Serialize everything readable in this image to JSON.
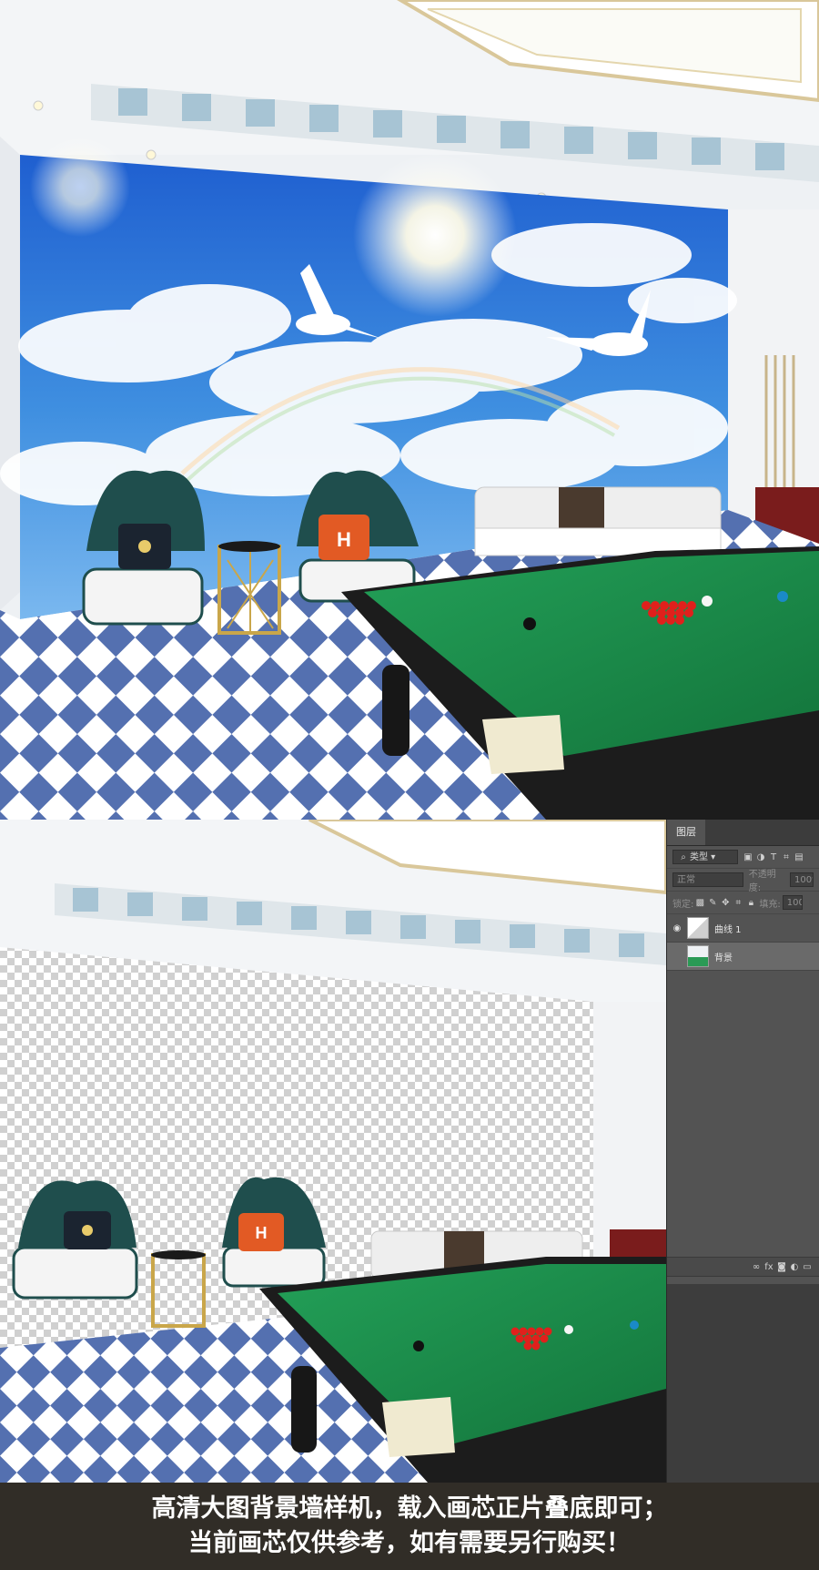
{
  "photoshop": {
    "panel_title": "图层",
    "filter_kind": "类型",
    "blend_mode": "正常",
    "opacity_label": "不透明度:",
    "opacity_value": "100%",
    "lock_label": "锁定:",
    "fill_label": "填充:",
    "fill_value": "100%",
    "footer_icons": [
      "link-icon",
      "fx-icon",
      "mask-icon",
      "adjustment-icon",
      "folder-icon"
    ],
    "layers": [
      {
        "name": "曲线 1",
        "visible": true,
        "selected": false,
        "icon": "curves-adjustment-icon"
      },
      {
        "name": "背景",
        "visible": false,
        "selected": true,
        "icon": "image-thumbnail-icon"
      }
    ]
  },
  "caption": {
    "line1": "高清大图背景墙样机，载入画芯正片叠底即可；",
    "line2": "当前画芯仅供参考，如有需要另行购买！"
  },
  "pillow_letter": "H",
  "colors": {
    "sky_top": "#1f5fd0",
    "sky_light": "#5aa8ec",
    "felt_green": "#1a8a4a",
    "tile_blue": "#5470b0",
    "chair_teal": "#1f4e4d",
    "pillow_orange": "#e25a24",
    "caption_bg": "#312d27",
    "panel_bg": "#535353"
  }
}
